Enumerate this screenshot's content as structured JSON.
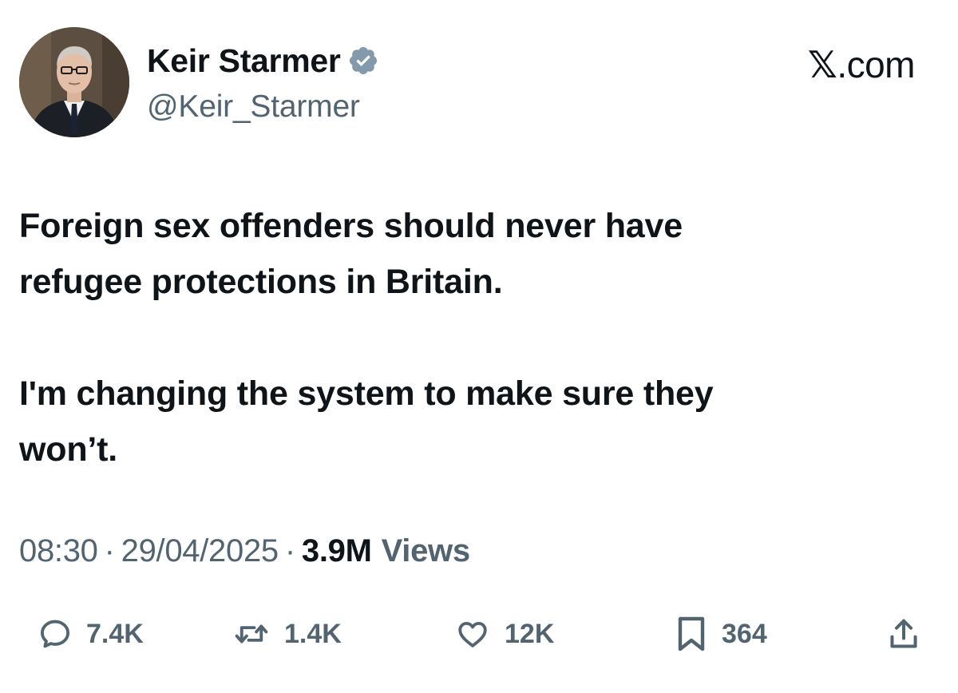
{
  "author": {
    "display_name": "Keir Starmer",
    "handle": "@Keir_Starmer",
    "verified": true,
    "avatar_icon": "profile-photo"
  },
  "site": {
    "label_x": "𝕏",
    "label_rest": ".com"
  },
  "tweet": {
    "paragraph_1": "Foreign sex offenders should never have\nrefugee protections in Britain.",
    "paragraph_2": "I'm changing the system to make sure they\nwon’t."
  },
  "meta": {
    "time": "08:30",
    "separator": "·",
    "date": "29/04/2025",
    "views_count": "3.9M",
    "views_label": "Views"
  },
  "actions": {
    "reply": {
      "icon": "reply-icon",
      "count": "7.4K"
    },
    "repost": {
      "icon": "repost-icon",
      "count": "1.4K"
    },
    "like": {
      "icon": "heart-icon",
      "count": "12K"
    },
    "bookmark": {
      "icon": "bookmark-icon",
      "count": "364"
    },
    "share": {
      "icon": "share-icon"
    }
  },
  "colors": {
    "text_primary": "#0f1419",
    "text_secondary": "#536471",
    "verified_badge": "#829aab",
    "background": "#ffffff"
  }
}
